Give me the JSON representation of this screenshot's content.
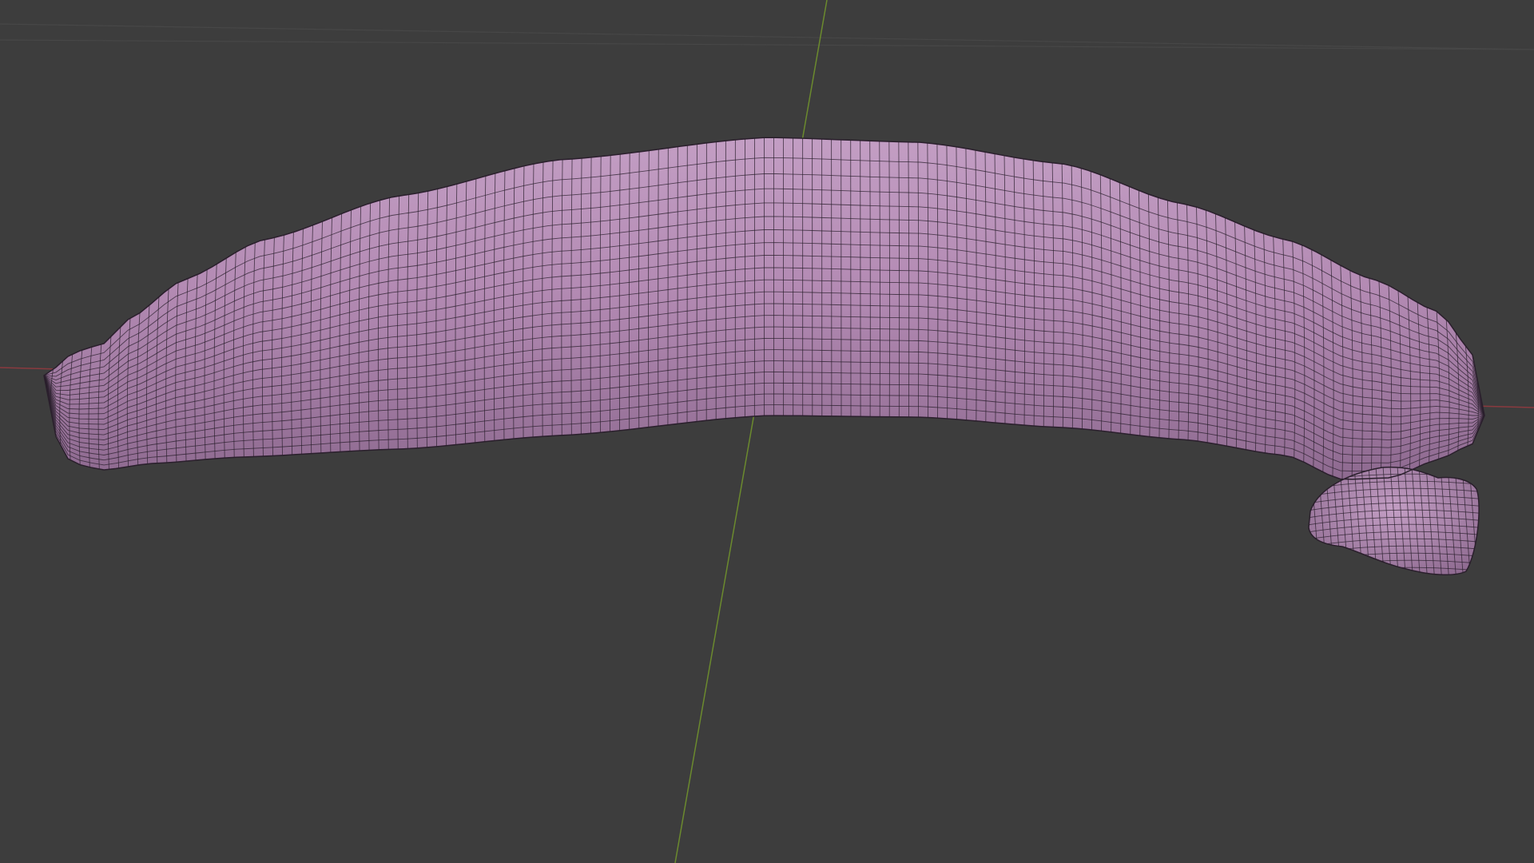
{
  "app": {
    "view": "3d-viewport",
    "shading_mode": "solid-with-wireframe-overlay"
  },
  "colors": {
    "background": "#3d3d3d",
    "grid_line": "#474747",
    "x_axis": "#8a3a3f",
    "y_axis": "#6b8a2e",
    "mesh_base": "#b38ab3",
    "mesh_highlight": "#c39ec4",
    "mesh_shadow": "#8e6a90",
    "wire": "#2a1f2c"
  },
  "scene": {
    "object": {
      "icon": "banana-mesh",
      "display": "selected-mesh-with-wireframe"
    },
    "grid": true,
    "axes": [
      "x-axis",
      "y-axis"
    ]
  }
}
